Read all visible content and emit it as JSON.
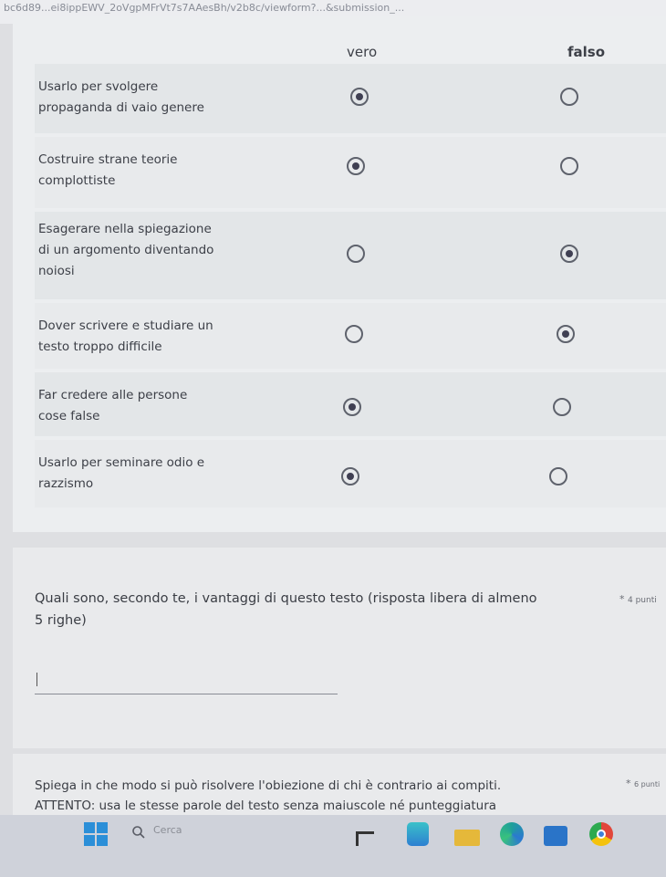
{
  "browser": {
    "url": "bc6d89...ei8ippEWV_2oVgpMFrVt7s7AAesBh/v2b8c/viewform?...&submission_..."
  },
  "grid": {
    "columns": [
      "vero",
      "falso"
    ],
    "rows": [
      {
        "lines": [
          "Usarlo per svolgere",
          "propaganda di vaio genere"
        ],
        "selected": "vero"
      },
      {
        "lines": [
          "Costruire strane teorie",
          "complottiste"
        ],
        "selected": "vero"
      },
      {
        "lines": [
          "Esagerare nella spiegazione",
          "di un argomento diventando",
          "noiosi"
        ],
        "selected": "falso"
      },
      {
        "lines": [
          "Dover scrivere e studiare un",
          "testo troppo difficile"
        ],
        "selected": "falso"
      },
      {
        "lines": [
          "Far credere alle persone",
          "cose false"
        ],
        "selected": "vero"
      },
      {
        "lines": [
          "Usarlo per seminare odio e",
          "razzismo"
        ],
        "selected": "vero"
      }
    ]
  },
  "question2": {
    "title_line1": "Quali sono, secondo te, i vantaggi di questo testo (risposta libera di almeno",
    "title_line2": "5 righe)",
    "required": "*",
    "points": "4 punti",
    "answer": ""
  },
  "question3": {
    "title_line1": "Spiega in che modo si può risolvere l'obiezione di chi è contrario ai compiti.",
    "title_line2": "ATTENTO: usa le stesse parole del testo senza maiuscole né punteggiatura",
    "required": "*",
    "points": "6 punti"
  },
  "taskbar": {
    "search_placeholder": "Cerca",
    "icons": [
      "windows-start-icon",
      "search-icon",
      "task-view-icon",
      "widgets-icon",
      "file-explorer-icon",
      "edge-icon",
      "store-icon",
      "chrome-icon"
    ]
  },
  "colors": {
    "radio_selected": "#3f3f52",
    "card_bg": "#eceef0",
    "row_bg": "#e3e6e8"
  }
}
